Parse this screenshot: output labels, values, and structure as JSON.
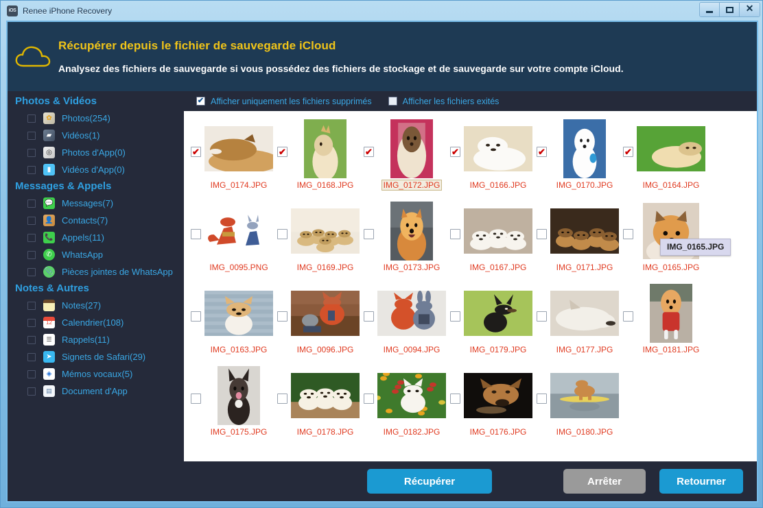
{
  "window": {
    "title": "Renee iPhone Recovery",
    "app_icon": "ios-icon",
    "minimize_label": "",
    "maximize_label": "",
    "close_label": "✕"
  },
  "banner": {
    "icon": "cloud-icon",
    "title": "Récupérer depuis le fichier de sauvegarde iCloud",
    "subtitle": "Analysez des fichiers de sauvegarde si vous possédez des fichiers de stockage et de sauvegarde sur votre compte iCloud."
  },
  "sidebar": {
    "groups": [
      {
        "title": "Photos & Vidéos",
        "items": [
          {
            "label": "Photos(254)",
            "icon": "photos-icon",
            "icon_class": "ic-photos",
            "glyph": "✿",
            "checked": false
          },
          {
            "label": "Vidéos(1)",
            "icon": "video-icon",
            "icon_class": "ic-videos",
            "glyph": "▰",
            "checked": false
          },
          {
            "label": "Photos d'App(0)",
            "icon": "app-photo-icon",
            "icon_class": "ic-appphoto",
            "glyph": "◎",
            "checked": false
          },
          {
            "label": "Vidéos d'App(0)",
            "icon": "app-video-icon",
            "icon_class": "ic-appvideo",
            "glyph": "▮",
            "checked": false
          }
        ]
      },
      {
        "title": "Messages & Appels",
        "items": [
          {
            "label": "Messages(7)",
            "icon": "messages-icon",
            "icon_class": "ic-messages",
            "glyph": "💬",
            "checked": false
          },
          {
            "label": "Contacts(7)",
            "icon": "contacts-icon",
            "icon_class": "ic-contacts",
            "glyph": "👤",
            "checked": false
          },
          {
            "label": "Appels(11)",
            "icon": "phone-icon",
            "icon_class": "ic-calls",
            "glyph": "📞",
            "checked": false
          },
          {
            "label": "WhatsApp",
            "icon": "whatsapp-icon",
            "icon_class": "ic-whatsapp",
            "glyph": "✆",
            "checked": false
          },
          {
            "label": "Pièces jointes de WhatsApp",
            "icon": "attachment-icon",
            "icon_class": "ic-wa-att",
            "glyph": "📎",
            "checked": false
          }
        ]
      },
      {
        "title": "Notes & Autres",
        "items": [
          {
            "label": "Notes(27)",
            "icon": "notes-icon",
            "icon_class": "ic-notes",
            "glyph": "",
            "checked": false
          },
          {
            "label": "Calendrier(108)",
            "icon": "calendar-icon",
            "icon_class": "ic-calendar",
            "glyph": "12",
            "checked": false
          },
          {
            "label": "Rappels(11)",
            "icon": "reminders-icon",
            "icon_class": "ic-reminders",
            "glyph": "☰",
            "checked": false
          },
          {
            "label": "Signets de Safari(29)",
            "icon": "safari-icon",
            "icon_class": "ic-safari",
            "glyph": "➤",
            "checked": false
          },
          {
            "label": "Mémos vocaux(5)",
            "icon": "voice-memo-icon",
            "icon_class": "ic-voice",
            "glyph": "◈",
            "checked": false
          },
          {
            "label": "Document d'App",
            "icon": "document-icon",
            "icon_class": "ic-doc",
            "glyph": "▤",
            "checked": false
          }
        ]
      }
    ]
  },
  "filterbar": {
    "options": [
      {
        "label": "Afficher uniquement les fichiers supprimés",
        "checked": true,
        "tick": "✔"
      },
      {
        "label": "Afficher les fichiers exités",
        "checked": false,
        "tick": ""
      }
    ]
  },
  "gallery": {
    "tooltip": "IMG_0165.JPG",
    "check_glyph": "✔",
    "rows": [
      [
        {
          "name": "IMG_0174.JPG",
          "checked": true,
          "selected": false,
          "shape": "landscape",
          "art": "shiba-sleeping"
        },
        {
          "name": "IMG_0168.JPG",
          "checked": true,
          "selected": false,
          "shape": "portrait",
          "art": "golden-crown"
        },
        {
          "name": "IMG_0172.JPG",
          "checked": true,
          "selected": true,
          "shape": "portrait",
          "art": "shihtzu-pink"
        },
        {
          "name": "IMG_0166.JPG",
          "checked": true,
          "selected": false,
          "shape": "landscape",
          "art": "white-puppy"
        },
        {
          "name": "IMG_0170.JPG",
          "checked": true,
          "selected": false,
          "shape": "portrait",
          "art": "samoyed-blue"
        },
        {
          "name": "IMG_0164.JPG",
          "checked": true,
          "selected": false,
          "shape": "landscape",
          "art": "lab-grass"
        }
      ],
      [
        {
          "name": "IMG_0095.PNG",
          "checked": false,
          "selected": false,
          "shape": "landscape",
          "art": "zootopia-run"
        },
        {
          "name": "IMG_0169.JPG",
          "checked": false,
          "selected": false,
          "shape": "landscape",
          "art": "puppies-couch"
        },
        {
          "name": "IMG_0173.JPG",
          "checked": false,
          "selected": false,
          "shape": "portrait",
          "art": "pomeranian"
        },
        {
          "name": "IMG_0167.JPG",
          "checked": false,
          "selected": false,
          "shape": "landscape",
          "art": "three-white-pups"
        },
        {
          "name": "IMG_0171.JPG",
          "checked": false,
          "selected": false,
          "shape": "landscape",
          "art": "dark-puppies"
        },
        {
          "name": "IMG_0165.JPG",
          "checked": false,
          "selected": false,
          "shape": "square",
          "art": "boo-lying"
        }
      ],
      [
        {
          "name": "IMG_0163.JPG",
          "checked": false,
          "selected": false,
          "shape": "landscape",
          "art": "corgi-deck"
        },
        {
          "name": "IMG_0096.JPG",
          "checked": false,
          "selected": false,
          "shape": "landscape",
          "art": "nick-desk"
        },
        {
          "name": "IMG_0094.JPG",
          "checked": false,
          "selected": false,
          "shape": "landscape",
          "art": "nick-judy"
        },
        {
          "name": "IMG_0179.JPG",
          "checked": false,
          "selected": false,
          "shape": "landscape",
          "art": "minpin-grass"
        },
        {
          "name": "IMG_0177.JPG",
          "checked": false,
          "selected": false,
          "shape": "landscape",
          "art": "sleepy-white"
        },
        {
          "name": "IMG_0181.JPG",
          "checked": false,
          "selected": false,
          "shape": "portrait",
          "art": "boo-red-coat"
        }
      ],
      [
        {
          "name": "IMG_0175.JPG",
          "checked": false,
          "selected": false,
          "shape": "portrait",
          "art": "frenchie-tongue"
        },
        {
          "name": "IMG_0178.JPG",
          "checked": false,
          "selected": false,
          "shape": "landscape",
          "art": "three-goldens"
        },
        {
          "name": "IMG_0182.JPG",
          "checked": false,
          "selected": false,
          "shape": "landscape",
          "art": "westie-flowers"
        },
        {
          "name": "IMG_0176.JPG",
          "checked": false,
          "selected": false,
          "shape": "landscape",
          "art": "lab-black-bg"
        },
        {
          "name": "IMG_0180.JPG",
          "checked": false,
          "selected": false,
          "shape": "landscape",
          "art": "surf-dog"
        }
      ]
    ]
  },
  "footer": {
    "recover_label": "Récupérer",
    "stop_label": "Arrêter",
    "back_label": "Retourner"
  },
  "colors": {
    "accent_blue": "#1b9ad2",
    "banner_bg": "#1e3a54",
    "banner_title": "#f0c419",
    "panel_bg": "#252a3a",
    "filename_red": "#e03a20",
    "sidebar_link": "#3aa8e5",
    "stop_gray": "#9a9a9a"
  }
}
